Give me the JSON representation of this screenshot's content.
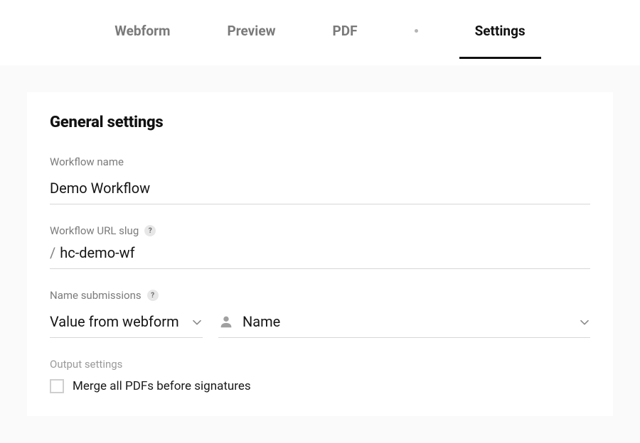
{
  "tabs": {
    "webform": "Webform",
    "preview": "Preview",
    "pdf": "PDF",
    "settings": "Settings"
  },
  "section": {
    "title": "General settings"
  },
  "fields": {
    "workflow_name": {
      "label": "Workflow name",
      "value": "Demo Workflow"
    },
    "workflow_slug": {
      "label": "Workflow URL slug",
      "prefix": "/",
      "value": "hc-demo-wf"
    },
    "name_submissions": {
      "label": "Name submissions",
      "source_value": "Value from webform",
      "field_value": "Name"
    },
    "output": {
      "label": "Output settings",
      "merge_label": "Merge all PDFs before signatures",
      "merge_checked": false
    }
  },
  "help_symbol": "?"
}
